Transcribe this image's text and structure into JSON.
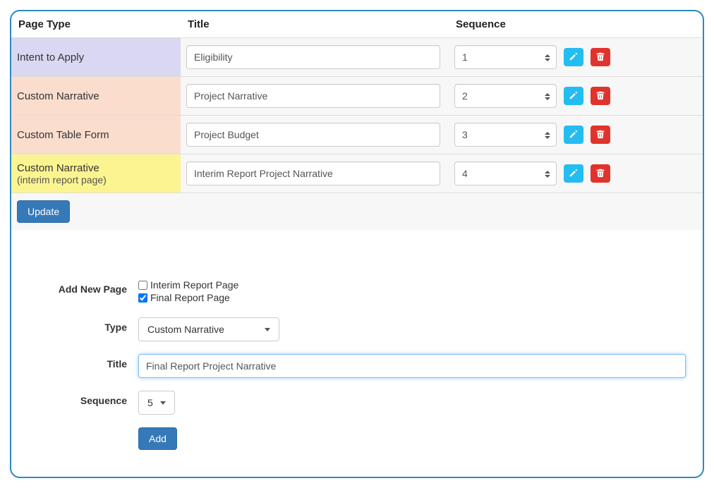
{
  "headers": {
    "page_type": "Page Type",
    "title": "Title",
    "sequence": "Sequence"
  },
  "rows": [
    {
      "page_type": "Intent to Apply",
      "subtitle": "",
      "bg": "bg-purple",
      "title": "Eligibility",
      "sequence": "1"
    },
    {
      "page_type": "Custom Narrative",
      "subtitle": "",
      "bg": "bg-peach",
      "title": "Project Narrative",
      "sequence": "2"
    },
    {
      "page_type": "Custom Table Form",
      "subtitle": "",
      "bg": "bg-peach",
      "title": "Project Budget",
      "sequence": "3"
    },
    {
      "page_type": "Custom Narrative",
      "subtitle": "(interim report page)",
      "bg": "bg-yellow",
      "title": "Interim Report Project Narrative",
      "sequence": "4"
    }
  ],
  "buttons": {
    "update": "Update",
    "add": "Add"
  },
  "form": {
    "labels": {
      "add_new_page": "Add New Page",
      "type": "Type",
      "title": "Title",
      "sequence": "Sequence"
    },
    "checkboxes": {
      "interim": {
        "label": "Interim Report Page",
        "checked": false
      },
      "final": {
        "label": "Final Report Page",
        "checked": true
      }
    },
    "type_value": "Custom Narrative",
    "title_value": "Final Report Project Narrative",
    "sequence_value": "5"
  }
}
